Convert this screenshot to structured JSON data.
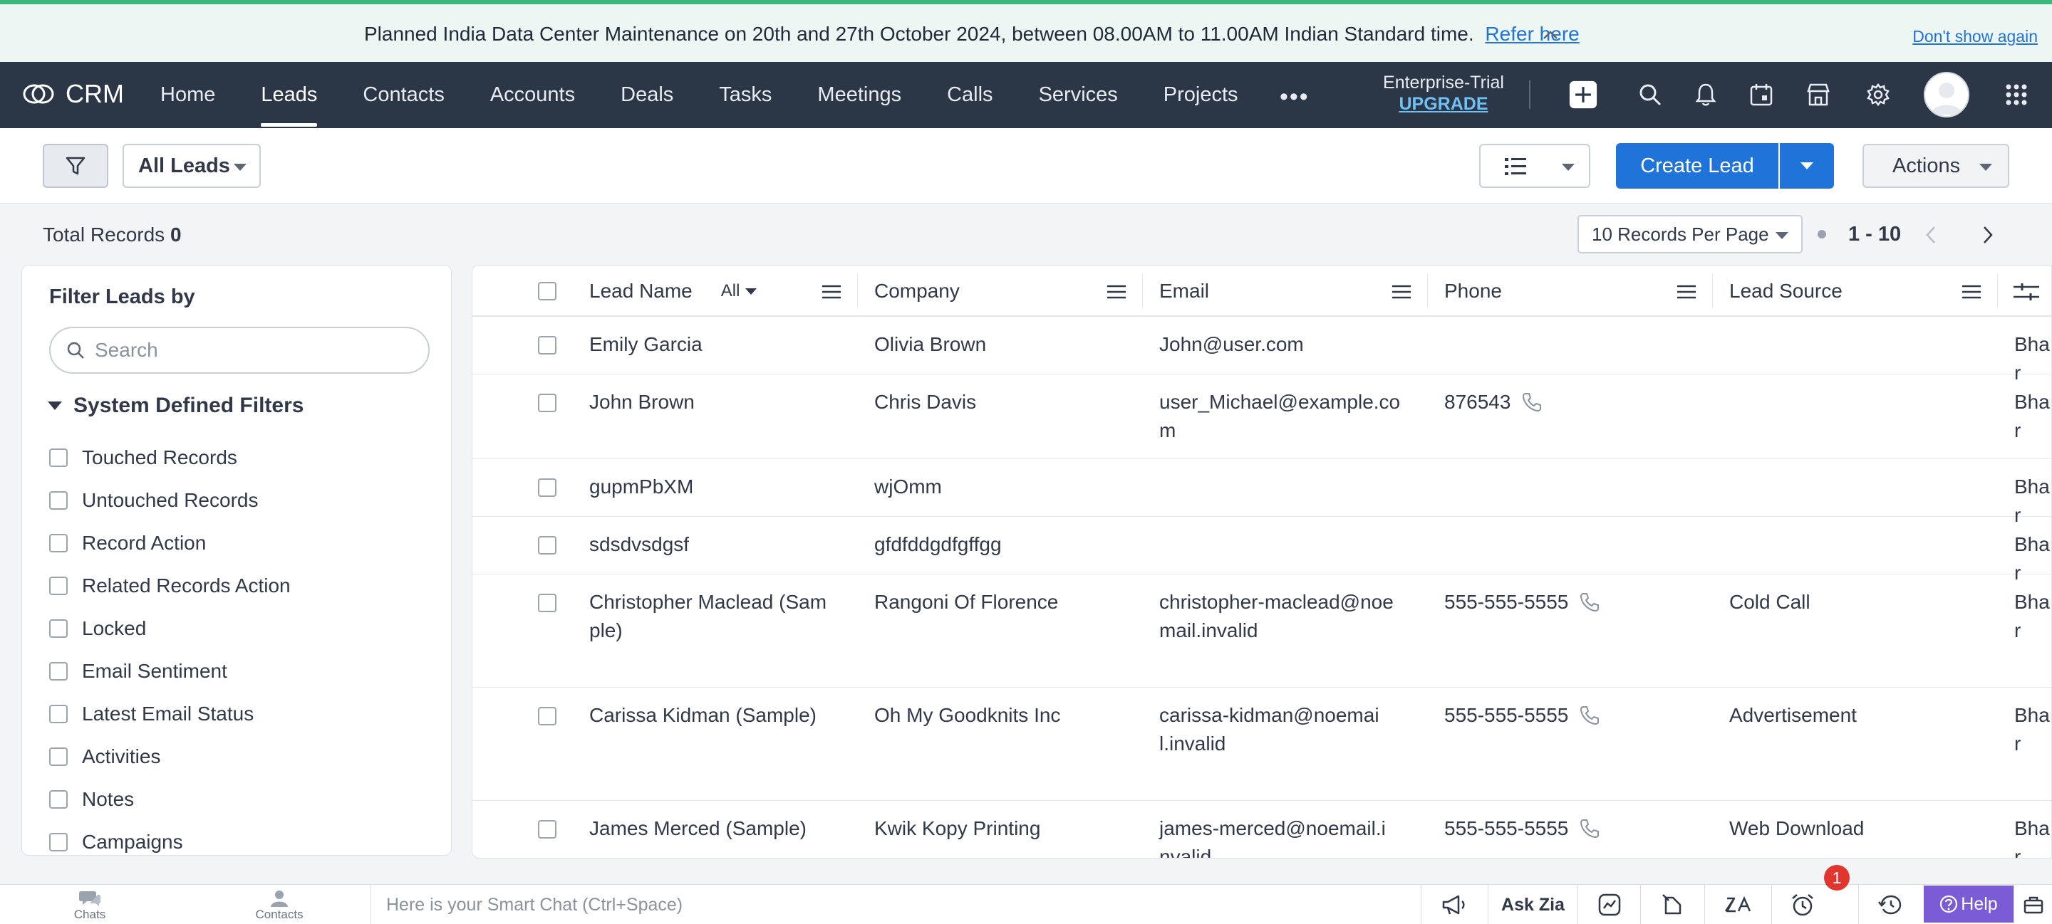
{
  "banner": {
    "message": "Planned India Data Center Maintenance on 20th and 27th October 2024, between 08.00AM to 11.00AM Indian Standard time.",
    "link": "Refer here",
    "dismiss": "Don't show again"
  },
  "nav": {
    "brand": "CRM",
    "items": [
      "Home",
      "Leads",
      "Contacts",
      "Accounts",
      "Deals",
      "Tasks",
      "Meetings",
      "Calls",
      "Services",
      "Projects"
    ],
    "active": "Leads",
    "edition": "Enterprise-Trial",
    "upgrade": "UPGRADE"
  },
  "toolbar": {
    "view": "All Leads",
    "create_label": "Create Lead",
    "actions_label": "Actions"
  },
  "records": {
    "total_label": "Total Records",
    "total_value": "0",
    "per_page": "10 Records Per Page",
    "range": "1 - 10"
  },
  "filters": {
    "title": "Filter Leads by",
    "search_placeholder": "Search",
    "section": "System Defined Filters",
    "items": [
      "Touched Records",
      "Untouched Records",
      "Record Action",
      "Related Records Action",
      "Locked",
      "Email Sentiment",
      "Latest Email Status",
      "Activities",
      "Notes",
      "Campaigns"
    ]
  },
  "table": {
    "columns": [
      "Lead Name",
      "Company",
      "Email",
      "Phone",
      "Lead Source"
    ],
    "lead_name_filter": "All",
    "rows": [
      {
        "name": "Emily Garcia",
        "company": "Olivia Brown",
        "email": "John@user.com",
        "phone": "",
        "source": "",
        "owner": "Bhar"
      },
      {
        "name": "John Brown",
        "company": "Chris Davis",
        "email": "user_Michael@example.com",
        "phone": "876543",
        "source": "",
        "owner": "Bhar"
      },
      {
        "name": "gupmPbXM",
        "company": "wjOmm",
        "email": "",
        "phone": "",
        "source": "",
        "owner": "Bhar"
      },
      {
        "name": "sdsdvsdgsf",
        "company": "gfdfddgdfgffgg",
        "email": "",
        "phone": "",
        "source": "",
        "owner": "Bhar"
      },
      {
        "name": "Christopher Maclead (Sample)",
        "company": "Rangoni Of Florence",
        "email": "christopher-maclead@noemail.invalid",
        "phone": "555-555-5555",
        "source": "Cold Call",
        "owner": "Bhar"
      },
      {
        "name": "Carissa Kidman (Sample)",
        "company": "Oh My Goodknits Inc",
        "email": "carissa-kidman@noemail.invalid",
        "phone": "555-555-5555",
        "source": "Advertisement",
        "owner": "Bhar"
      },
      {
        "name": "James Merced (Sample)",
        "company": "Kwik Kopy Printing",
        "email": "james-merced@noemail.invalid",
        "phone": "555-555-5555",
        "source": "Web Download",
        "owner": "Bhar"
      }
    ]
  },
  "bottom": {
    "chats": "Chats",
    "contacts": "Contacts",
    "smart_chat": "Here is your Smart Chat (Ctrl+Space)",
    "ask_zia": "Ask Zia",
    "badge": "1",
    "help": "Help"
  },
  "colors": {
    "nav_bg": "#2b3646",
    "primary": "#1f73d9",
    "banner_bg": "#eef6f3",
    "banner_accent": "#3ab97a",
    "help_bg": "#7b5cd6",
    "badge": "#e3352f"
  }
}
